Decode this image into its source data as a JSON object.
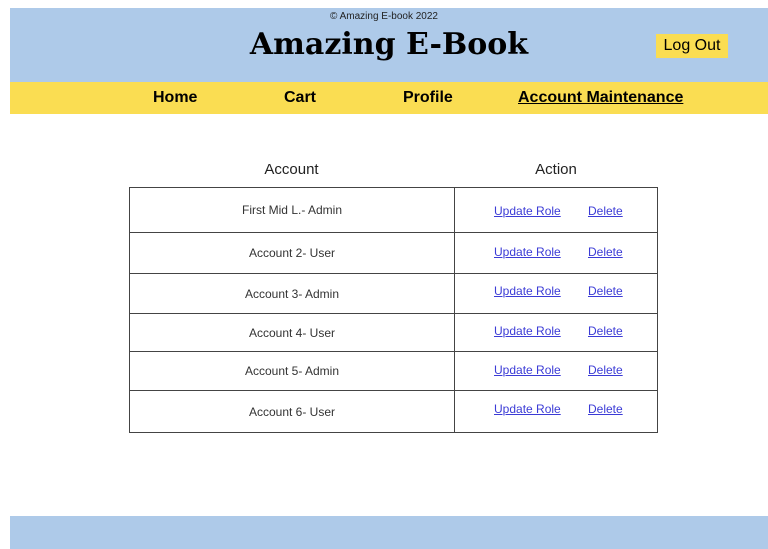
{
  "header": {
    "title": "Amazing E-Book",
    "logout_label": "Log Out"
  },
  "nav": {
    "items": [
      {
        "label": "Home"
      },
      {
        "label": "Cart"
      },
      {
        "label": "Profile"
      },
      {
        "label": "Account Maintenance"
      }
    ],
    "active": "Account Maintenance"
  },
  "table": {
    "headers": [
      "Account",
      "Action"
    ],
    "rows": [
      {
        "account": "First Mid L.- Admin",
        "update_label": "Update Role",
        "delete_label": "Delete"
      },
      {
        "account": "Account 2- User",
        "update_label": "Update Role",
        "delete_label": "Delete"
      },
      {
        "account": "Account 3- Admin",
        "update_label": "Update Role",
        "delete_label": "Delete"
      },
      {
        "account": "Account 4- User",
        "update_label": "Update Role",
        "delete_label": "Delete"
      },
      {
        "account": "Account 5- Admin",
        "update_label": "Update Role",
        "delete_label": "Delete"
      },
      {
        "account": "Account 6- User",
        "update_label": "Update Role",
        "delete_label": "Delete"
      }
    ]
  },
  "footer": {
    "text": "© Amazing E-book 2022"
  },
  "colors": {
    "header_bg": "#aecae9",
    "nav_bg": "#fadd52",
    "logout_bg": "#fadd52",
    "link": "#3b3bd6"
  }
}
